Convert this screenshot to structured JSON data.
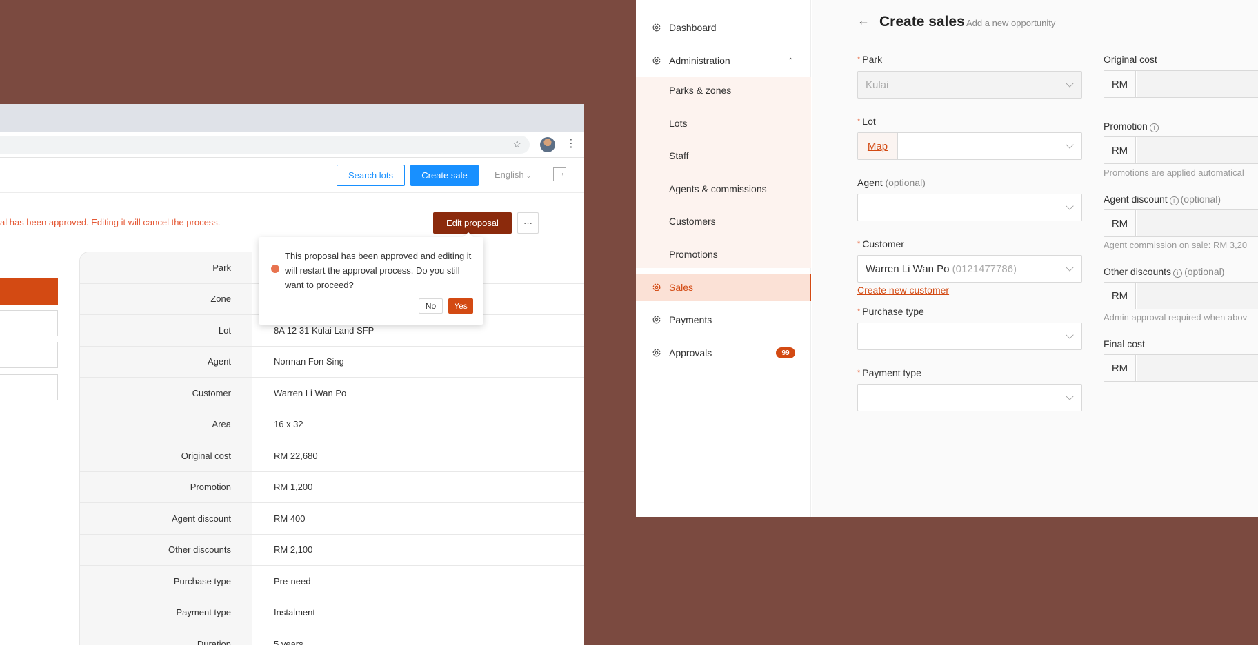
{
  "browser": {
    "toolbar": {
      "search_lots": "Search lots",
      "create_sale": "Create sale",
      "language": "English"
    },
    "warning_text": "al has been approved. Editing it will cancel the process.",
    "edit_proposal": "Edit proposal",
    "more": "···",
    "popconfirm": {
      "message": "This proposal has been approved and editing it will restart the approval process. Do you still want to proceed?",
      "no": "No",
      "yes": "Yes"
    },
    "details": [
      {
        "label": "Park",
        "value": ""
      },
      {
        "label": "Zone",
        "value": ""
      },
      {
        "label": "Lot",
        "value": "8A 12 31 Kulai Land SFP"
      },
      {
        "label": "Agent",
        "value": "Norman Fon Sing"
      },
      {
        "label": "Customer",
        "value": "Warren Li Wan Po"
      },
      {
        "label": "Area",
        "value": "16 x 32"
      },
      {
        "label": "Original cost",
        "value": "RM 22,680"
      },
      {
        "label": "Promotion",
        "value": "RM 1,200"
      },
      {
        "label": "Agent discount",
        "value": "RM 400"
      },
      {
        "label": "Other discounts",
        "value": "RM 2,100"
      },
      {
        "label": "Purchase type",
        "value": "Pre-need"
      },
      {
        "label": "Payment type",
        "value": "Instalment"
      },
      {
        "label": "Duration",
        "value": "5 years"
      }
    ]
  },
  "sidebar": {
    "dashboard": "Dashboard",
    "administration": "Administration",
    "sub": [
      "Parks & zones",
      "Lots",
      "Staff",
      "Agents & commissions",
      "Customers",
      "Promotions"
    ],
    "sales": "Sales",
    "payments": "Payments",
    "approvals": "Approvals",
    "approvals_badge": "99"
  },
  "form": {
    "title": "Create sales",
    "subtitle": "Add a new opportunity",
    "park_label": "Park",
    "park_value": "Kulai",
    "lot_label": "Lot",
    "map_label": "Map",
    "agent_label": "Agent",
    "optional": "(optional)",
    "customer_label": "Customer",
    "customer_name": "Warren Li Wan Po",
    "customer_phone": "(0121477786)",
    "create_customer": "Create new customer",
    "purchase_type_label": "Purchase type",
    "payment_type_label": "Payment type",
    "original_cost_label": "Original cost",
    "promotion_label": "Promotion",
    "promotion_hint": "Promotions are applied automatical",
    "agent_discount_label": "Agent discount",
    "agent_discount_hint": "Agent commission on sale: RM 3,20",
    "other_discounts_label": "Other discounts",
    "other_discounts_hint": "Admin approval required when abov",
    "final_cost_label": "Final cost",
    "currency": "RM"
  },
  "colors": {
    "accent": "#d34a13",
    "primary_blue": "#1890ff",
    "background": "#7b4a40"
  }
}
